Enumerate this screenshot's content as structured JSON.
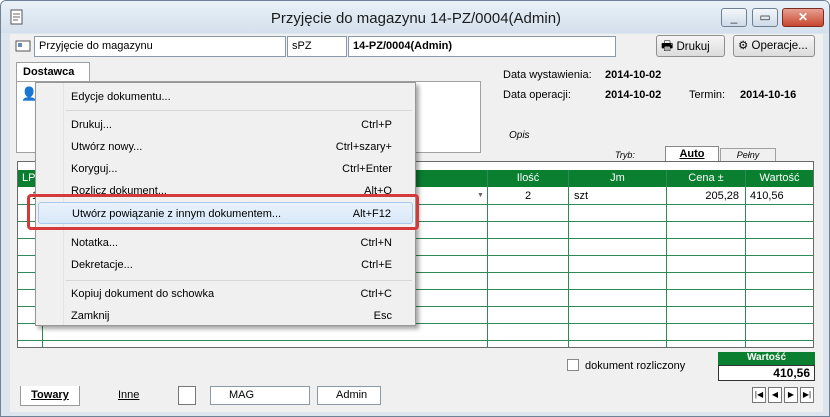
{
  "window": {
    "title": "Przyjęcie do magazynu 14-PZ/0004(Admin)",
    "minimize": "▭",
    "restore": "▭",
    "close": "✕"
  },
  "toolbar": {
    "doc_type": "Przyjęcie do magazynu",
    "series": "sPZ",
    "doc_number": "14-PZ/0004(Admin)",
    "print_label": "Drukuj",
    "operations_label": "Operacje..."
  },
  "dostawca": {
    "tab_label": "Dostawca"
  },
  "dates": {
    "issue_label": "Data wystawienia:",
    "issue_value": "2014-10-02",
    "op_label": "Data operacji:",
    "op_value": "2014-10-02",
    "due_label": "Termin:",
    "due_value": "2014-10-16",
    "opis_label": "Opis"
  },
  "mode": {
    "label": "Tryb:",
    "auto": "Auto",
    "full": "Pełny"
  },
  "grid": {
    "columns": [
      "LP",
      "Ilość",
      "Jm",
      "Cena ±",
      "Wartość"
    ],
    "row": {
      "lp": "1",
      "qty": "2",
      "unit": "szt",
      "price": "205,28",
      "value": "410,56"
    }
  },
  "context_menu": {
    "items": [
      {
        "label": "Edycje dokumentu...",
        "shortcut": ""
      },
      {
        "label": "Drukuj...",
        "shortcut": "Ctrl+P"
      },
      {
        "label": "Utwórz nowy...",
        "shortcut": "Ctrl+szary+"
      },
      {
        "label": "Koryguj...",
        "shortcut": "Ctrl+Enter"
      },
      {
        "label": "Rozlicz dokument...",
        "shortcut": "Alt+O"
      },
      {
        "label": "Utwórz powiązanie z innym dokumentem...",
        "shortcut": "Alt+F12"
      },
      {
        "label": "Notatka...",
        "shortcut": "Ctrl+N"
      },
      {
        "label": "Dekretacje...",
        "shortcut": "Ctrl+E"
      },
      {
        "label": "Kopiuj dokument do schowka",
        "shortcut": "Ctrl+C"
      },
      {
        "label": "Zamknij",
        "shortcut": "Esc"
      }
    ]
  },
  "footer": {
    "settled_label": "dokument rozliczony",
    "total_label": "Wartość",
    "total_value": "410,56"
  },
  "bottom_tabs": {
    "towary": "Towary",
    "inne": "Inne",
    "warehouse": "MAG",
    "user": "Admin"
  },
  "colors": {
    "grid_header": "#0a7f2f",
    "highlight_box": "#d33a3a"
  }
}
